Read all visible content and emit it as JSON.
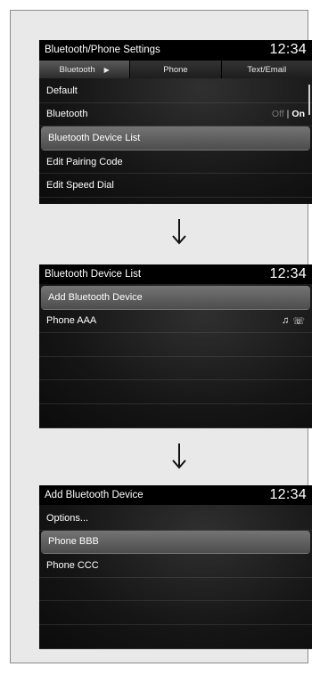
{
  "screen1": {
    "title": "Bluetooth/Phone Settings",
    "clock": "12:34",
    "tabs": [
      {
        "label": "Bluetooth",
        "arrow": "▶"
      },
      {
        "label": "Phone"
      },
      {
        "label": "Text/Email"
      }
    ],
    "rows": [
      {
        "label": "Default"
      },
      {
        "label": "Bluetooth",
        "toggle": {
          "off": "Off",
          "sep": "|",
          "on": "On"
        }
      },
      {
        "label": "Bluetooth Device List",
        "selected": true
      },
      {
        "label": "Edit Pairing Code"
      },
      {
        "label": "Edit Speed Dial"
      }
    ]
  },
  "screen2": {
    "title": "Bluetooth Device List",
    "clock": "12:34",
    "rows": [
      {
        "label": "Add Bluetooth Device",
        "selected": true
      },
      {
        "label": "Phone AAA",
        "icons": [
          "music-note-icon",
          "phone-handset-icon"
        ]
      }
    ]
  },
  "screen3": {
    "title": "Add Bluetooth Device",
    "clock": "12:34",
    "rows": [
      {
        "label": "Options..."
      },
      {
        "label": "Phone BBB",
        "selected": true
      },
      {
        "label": "Phone CCC"
      }
    ]
  },
  "icons": {
    "music": "♫",
    "phone": "☏"
  },
  "colors": {
    "screen_bg": "#101010",
    "selection": "#6a6a6a",
    "panel_bg": "#e9e9e9"
  }
}
